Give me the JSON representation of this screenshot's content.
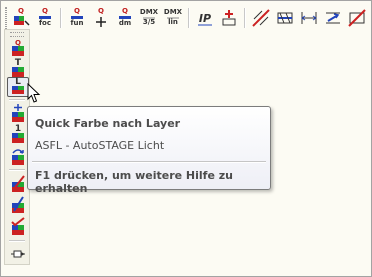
{
  "colors": {
    "background": "#fcfbf2",
    "tooltip_text": "#4c4c4c",
    "icon_red": "#cc2222",
    "icon_blue": "#2244bb",
    "icon_green": "#22aa33"
  },
  "top_toolbar": {
    "buttons": [
      {
        "icon": "query-icon",
        "label_top": "Q",
        "label_bottom": ""
      },
      {
        "icon": "query-foc-icon",
        "label_top": "Q",
        "label_bottom": "foc"
      },
      {
        "icon": "query-fun-icon",
        "label_top": "Q",
        "label_bottom": "fun"
      },
      {
        "icon": "query-plus-icon",
        "label_top": "Q",
        "label_bottom": ""
      },
      {
        "icon": "query-dm-icon",
        "label_top": "Q",
        "label_bottom": "dm"
      },
      {
        "icon": "dmx-35-icon",
        "label_top": "DMX",
        "label_bottom": "3/5"
      },
      {
        "icon": "dmx-lin-icon",
        "label_top": "DMX",
        "label_bottom": "lin"
      },
      {
        "icon": "ip-icon",
        "label_top": "IP",
        "label_bottom": ""
      },
      {
        "icon": "red-plus-icon",
        "label_top": "",
        "label_bottom": ""
      },
      {
        "icon": "diagonal-hatch-icon",
        "label_top": "",
        "label_bottom": ""
      },
      {
        "icon": "hatch-rect-icon",
        "label_top": "",
        "label_bottom": ""
      },
      {
        "icon": "dimension-icon",
        "label_top": "",
        "label_bottom": ""
      },
      {
        "icon": "swap-icon",
        "label_top": "",
        "label_bottom": ""
      },
      {
        "icon": "no-entry-icon",
        "label_top": "",
        "label_bottom": ""
      }
    ]
  },
  "left_toolbar": {
    "buttons": [
      {
        "icon": "quick-color-icon",
        "label": "Q",
        "active": false
      },
      {
        "icon": "text-color-icon",
        "label": "T",
        "active": false
      },
      {
        "icon": "quick-color-layer-icon",
        "label": "L",
        "active": true
      },
      {
        "icon": "cross-color-icon",
        "label": "",
        "active": false
      },
      {
        "icon": "number-color-icon",
        "label": "1",
        "active": false
      },
      {
        "icon": "rotate-color-icon",
        "label": "",
        "active": false
      },
      {
        "icon": "pen-red-icon",
        "label": "",
        "active": false
      },
      {
        "icon": "pen-blue-icon",
        "label": "",
        "active": false
      },
      {
        "icon": "pen-check-icon",
        "label": "",
        "active": false
      },
      {
        "icon": "flag-icon",
        "label": "",
        "active": false
      }
    ]
  },
  "tooltip": {
    "title": "Quick Farbe nach Layer",
    "subtitle": "ASFL - AutoSTAGE Licht",
    "help": "F1 drücken, um weitere Hilfe zu erhalten"
  }
}
